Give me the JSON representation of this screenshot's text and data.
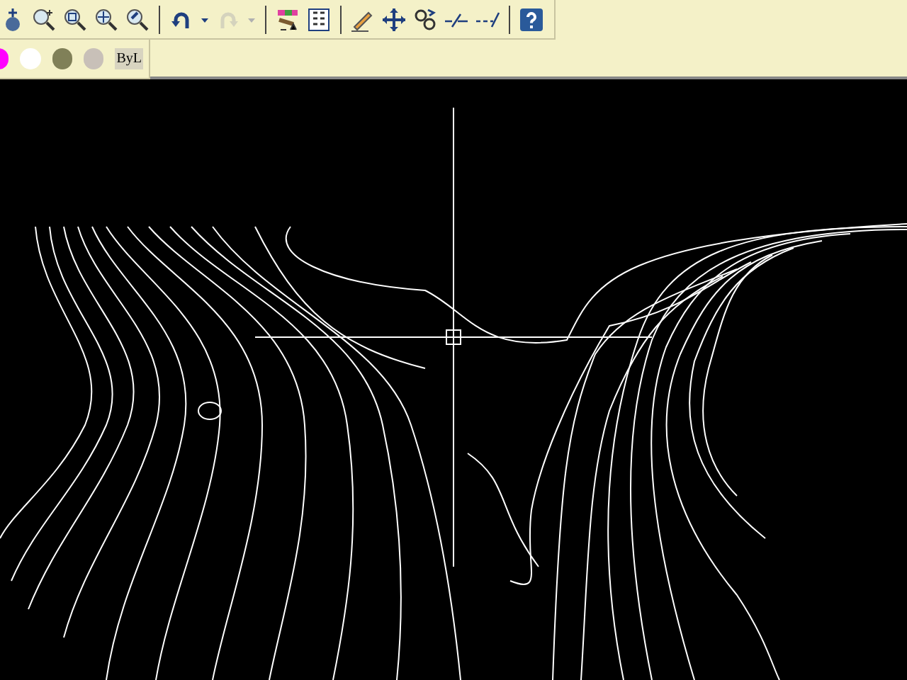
{
  "standard_toolbar": {
    "tools": [
      {
        "kind": "pan",
        "disabled": false
      },
      {
        "kind": "zoom",
        "disabled": false
      },
      {
        "kind": "zoom-window",
        "disabled": false
      },
      {
        "kind": "zoom-extents",
        "disabled": false
      },
      {
        "kind": "zoom-previous",
        "disabled": false
      },
      {
        "kind": "separator"
      },
      {
        "kind": "undo",
        "disabled": false
      },
      {
        "kind": "dropdown",
        "disabled": false
      },
      {
        "kind": "redo",
        "disabled": true
      },
      {
        "kind": "dropdown",
        "disabled": true
      },
      {
        "kind": "separator"
      },
      {
        "kind": "properties",
        "disabled": false
      },
      {
        "kind": "grid",
        "disabled": false
      },
      {
        "kind": "separator"
      },
      {
        "kind": "pencil",
        "disabled": false
      },
      {
        "kind": "move",
        "disabled": false
      },
      {
        "kind": "chain",
        "disabled": false
      },
      {
        "kind": "break",
        "disabled": false
      },
      {
        "kind": "extend",
        "disabled": false
      },
      {
        "kind": "separator"
      },
      {
        "kind": "help",
        "disabled": false
      }
    ]
  },
  "properties_toolbar": {
    "swatches": [
      {
        "color": "#ff00ff"
      },
      {
        "color": "#ffffff"
      },
      {
        "color": "#808058"
      },
      {
        "color": "#c8c0b8"
      }
    ],
    "linetype": "ByL"
  }
}
